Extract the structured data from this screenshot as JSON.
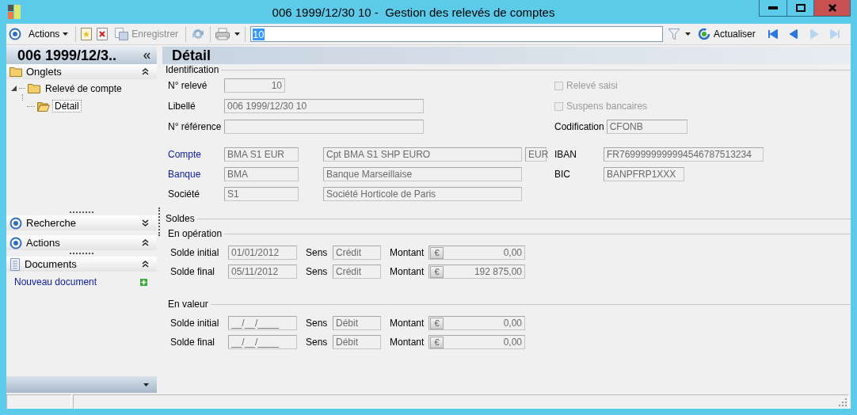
{
  "window": {
    "title": "006 1999/12/30 10 -  Gestion des relevés de comptes"
  },
  "toolbar": {
    "actions_label": "Actions",
    "save": {
      "label": "Enregistrer",
      "disabled": true
    },
    "search_value": "10",
    "search_value_selected": true,
    "refresh_label": "Actualiser",
    "nav": [
      {
        "kind": "first",
        "disabled": false
      },
      {
        "kind": "previous",
        "disabled": false
      },
      {
        "kind": "next",
        "disabled": true
      },
      {
        "kind": "last",
        "disabled": true
      }
    ]
  },
  "left_panel": {
    "title": "006 1999/12/3..",
    "sections": [
      {
        "kind": "tabs",
        "title": "Onglets",
        "expanded": true,
        "tree": [
          {
            "label": "Relevé de compte",
            "expanded": true,
            "selected": false,
            "children": [
              {
                "label": "Détail",
                "selected": true
              }
            ]
          }
        ]
      },
      {
        "kind": "search",
        "title": "Recherche",
        "expanded": false
      },
      {
        "kind": "actions",
        "title": "Actions",
        "expanded": true
      },
      {
        "kind": "documents",
        "title": "Documents",
        "expanded": true,
        "link": "Nouveau document"
      }
    ]
  },
  "detail": {
    "title": "Détail",
    "identification": {
      "legend": "Identification",
      "fields": [
        {
          "label": "N° relevé",
          "kind": "number",
          "values": [
            "10"
          ]
        },
        {
          "label": "Libellé",
          "kind": "text",
          "values": [
            "006 1999/12/30 10"
          ]
        },
        {
          "label": "N° référence",
          "kind": "text"
        }
      ],
      "options": [
        {
          "label": "Relevé saisi",
          "checked": false,
          "disabled": true
        },
        {
          "label": "Suspens bancaires",
          "checked": false,
          "disabled": true
        }
      ],
      "codification": {
        "label": "Codification",
        "value": "CFONB"
      },
      "bank_fields": [
        {
          "label": "Compte",
          "kind": "link",
          "values": [
            "BMA S1 EUR",
            "Cpt BMA S1 SHP EURO",
            "EUR"
          ]
        },
        {
          "label": "Banque",
          "kind": "link",
          "values": [
            "BMA",
            "Banque Marseillaise"
          ]
        },
        {
          "label": "Société",
          "kind": "text",
          "values": [
            "S1",
            "Société Horticole de Paris"
          ]
        }
      ],
      "iban": {
        "label": "IBAN",
        "value": "FR7699999999994546787513234"
      },
      "bic": {
        "label": "BIC",
        "value": "BANPFRP1XXX"
      }
    },
    "balances": {
      "legend": "Soldes",
      "groups": [
        {
          "legend": "En opération",
          "rows": [
            {
              "label": "Solde initial",
              "date": "01/01/2012",
              "sens_label": "Sens",
              "sens": "Crédit",
              "amount_label": "Montant",
              "currency": "€",
              "amount": "0,00"
            },
            {
              "label": "Solde final",
              "date": "05/11/2012",
              "sens_label": "Sens",
              "sens": "Crédit",
              "amount_label": "Montant",
              "currency": "€",
              "amount": "192 875,00"
            }
          ]
        },
        {
          "legend": "En valeur",
          "rows": [
            {
              "label": "Solde initial",
              "date": "__/__/____",
              "sens_label": "Sens",
              "sens": "Débit",
              "amount_label": "Montant",
              "currency": "€",
              "amount": "0,00"
            },
            {
              "label": "Solde final",
              "date": "__/__/____",
              "sens_label": "Sens",
              "sens": "Débit",
              "amount_label": "Montant",
              "currency": "€",
              "amount": "0,00"
            }
          ]
        }
      ]
    }
  }
}
